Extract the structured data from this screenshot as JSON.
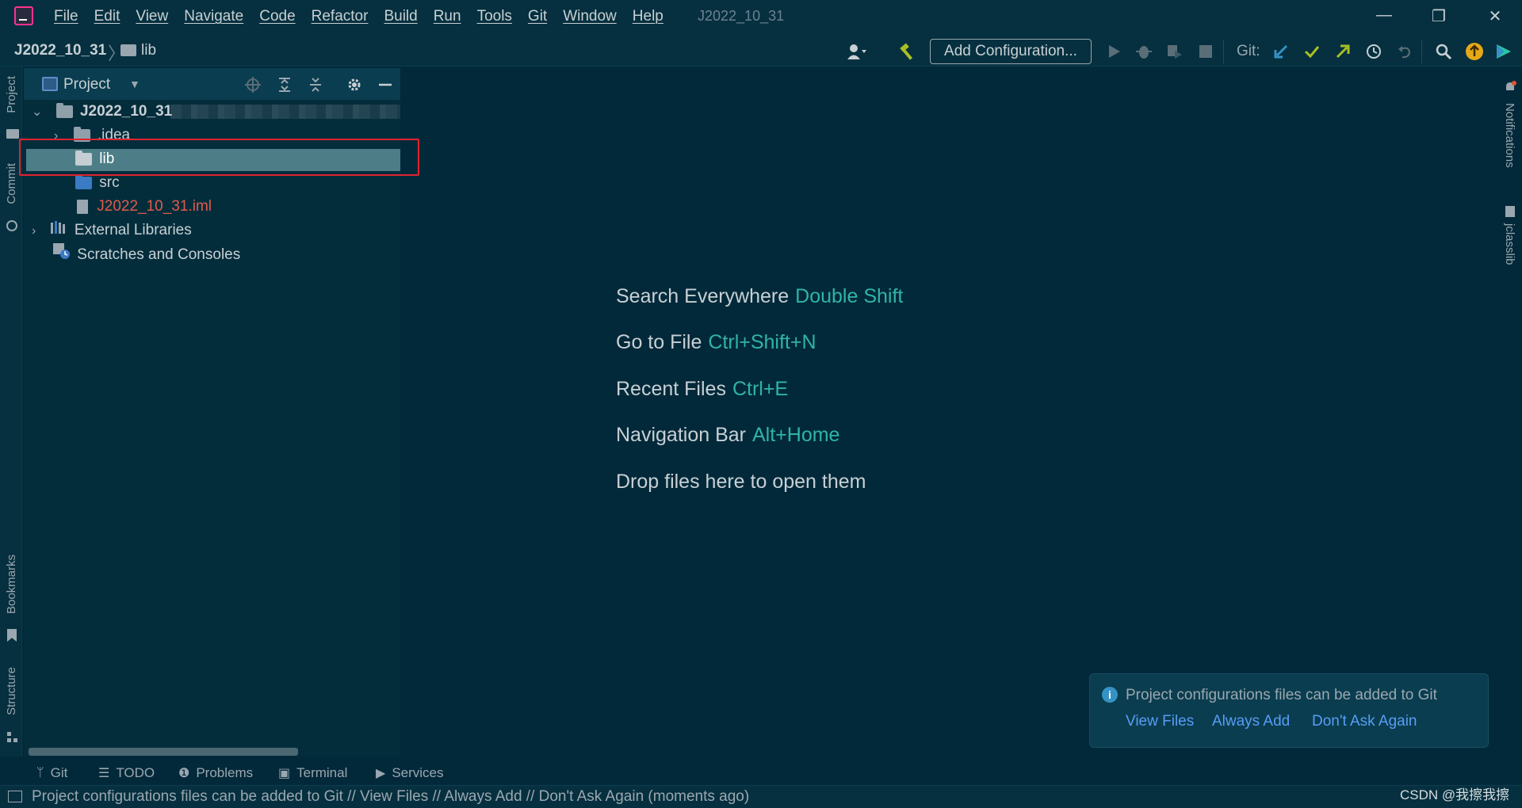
{
  "menu": [
    "File",
    "Edit",
    "View",
    "Navigate",
    "Code",
    "Refactor",
    "Build",
    "Run",
    "Tools",
    "Git",
    "Window",
    "Help"
  ],
  "window_title": "J2022_10_31",
  "window_controls": {
    "minimize": "—",
    "restore": "❐",
    "close": "✕"
  },
  "breadcrumb": {
    "root": "J2022_10_31",
    "separator": "〉",
    "current": "lib"
  },
  "toolbar": {
    "add_configuration": "Add Configuration...",
    "git_label": "Git:"
  },
  "left_stripe": {
    "project": "Project",
    "commit": "Commit",
    "bookmarks": "Bookmarks",
    "structure": "Structure"
  },
  "right_stripe": {
    "notifications": "Notifications",
    "jclasslib": "jclasslib"
  },
  "project_panel": {
    "title": "Project",
    "tree": {
      "root": "J2022_10_31",
      "idea": ".idea",
      "lib": "lib",
      "src": "src",
      "iml": "J2022_10_31.iml",
      "external": "External Libraries",
      "scratches": "Scratches and Consoles"
    }
  },
  "welcome": [
    {
      "label": "Search Everywhere",
      "key": "Double Shift"
    },
    {
      "label": "Go to File",
      "key": "Ctrl+Shift+N"
    },
    {
      "label": "Recent Files",
      "key": "Ctrl+E"
    },
    {
      "label": "Navigation Bar",
      "key": "Alt+Home"
    },
    {
      "label": "Drop files here to open them",
      "key": ""
    }
  ],
  "notification": {
    "text": "Project configurations files can be added to Git",
    "view_files": "View Files",
    "always_add": "Always Add",
    "dont_ask": "Don't Ask Again"
  },
  "bottom_tabs": {
    "git": "Git",
    "todo": "TODO",
    "problems": "Problems",
    "terminal": "Terminal",
    "services": "Services"
  },
  "status": "Project configurations files can be added to Git // View Files // Always Add // Don't Ask Again (moments ago)",
  "watermark": "CSDN @我擦我擦",
  "colors": {
    "background": "#02293a",
    "accent_key": "#2fb5a4",
    "link": "#589df6",
    "selection": "#4d7e87",
    "highlight": "#e0242f"
  }
}
